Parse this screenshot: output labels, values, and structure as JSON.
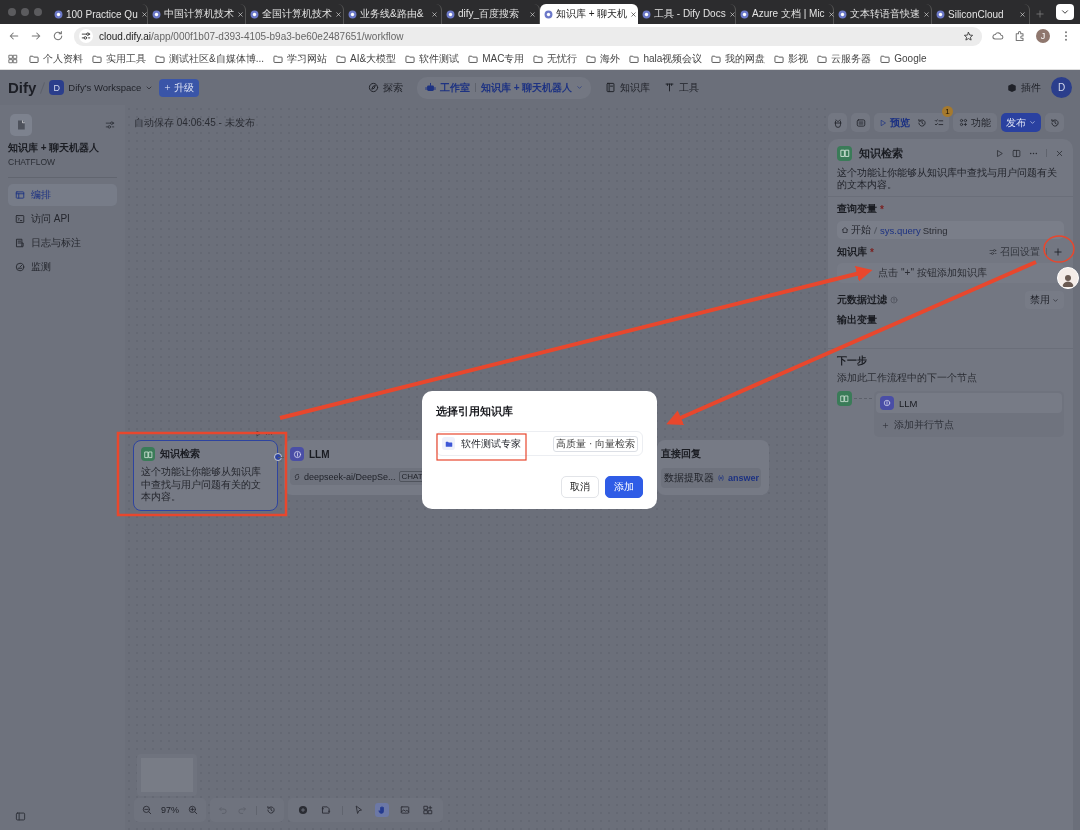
{
  "browser": {
    "tabs": [
      {
        "title": "100 Practice Qu",
        "selected": false
      },
      {
        "title": "中国计算机技术",
        "selected": false
      },
      {
        "title": "全国计算机技术",
        "selected": false
      },
      {
        "title": "业务线&路由&",
        "selected": false
      },
      {
        "title": "dify_百度搜索",
        "selected": false
      },
      {
        "title": "知识库 + 聊天机",
        "selected": true
      },
      {
        "title": "工具 - Dify Docs",
        "selected": false
      },
      {
        "title": "Azure 文档 | Mic",
        "selected": false
      },
      {
        "title": "文本转语音快速",
        "selected": false
      },
      {
        "title": "SiliconCloud",
        "selected": false
      }
    ],
    "url": "**cloud.dify.ai**/app/000f1b07-d393-4105-b9a3-be60e2487651/workflow",
    "profile_initial": "J",
    "bookmarks": [
      "个人资料",
      "实用工具",
      "测试社区&自媒体博...",
      "学习网站",
      "AI&大模型",
      "软件测试",
      "MAC专用",
      "无忧行",
      "海外",
      "hala视频会议",
      "我的网盘",
      "影视",
      "云服务器",
      "Google"
    ]
  },
  "header": {
    "logo": "Dify",
    "workspace_initial": "D",
    "workspace": "Dify's Workspace",
    "upgrade": "升级",
    "nav": [
      {
        "kind": "explore",
        "label": "探索"
      },
      {
        "kind": "studio",
        "label": "工作室",
        "app": "知识库 + 聊天机器人"
      },
      {
        "kind": "knowledge",
        "label": "知识库"
      },
      {
        "kind": "tools",
        "label": "工具"
      }
    ],
    "plugins": "插件",
    "user_initial": "D"
  },
  "sidebar": {
    "app_name": "知识库 + 聊天机器人",
    "app_type": "CHATFLOW",
    "items": [
      {
        "kind": "orchestrate",
        "label": "编排",
        "selected": true
      },
      {
        "kind": "api",
        "label": "访问 API",
        "selected": false
      },
      {
        "kind": "logs",
        "label": "日志与标注",
        "selected": false
      },
      {
        "kind": "monitor",
        "label": "监测",
        "selected": false
      }
    ]
  },
  "canvas": {
    "autosave": "自动保存 04:06:45 - 未发布",
    "nodes": [
      {
        "kind": "knowledge",
        "title": "知识检索",
        "description": "这个功能让你能够从知识库中查找与用户问题有关的文本内容。",
        "selected": true
      },
      {
        "kind": "llm",
        "title": "LLM",
        "model": "deepseek-ai/DeepSe...",
        "mode": "CHAT",
        "selected": false
      },
      {
        "kind": "answer",
        "title": "直接回复",
        "source": "数据提取器",
        "variable": "answer",
        "selected": false
      }
    ],
    "zoom": "97%",
    "tools": [
      {
        "kind": "add",
        "selected": false
      },
      {
        "kind": "note",
        "selected": false
      },
      {
        "kind": "pointer",
        "selected": false
      },
      {
        "kind": "hand",
        "selected": true
      },
      {
        "kind": "image",
        "selected": false
      },
      {
        "kind": "layout",
        "selected": false
      }
    ]
  },
  "toolbar": {
    "preview": "预览",
    "checklist_count": "1",
    "features": "功能",
    "publish": "发布"
  },
  "panel": {
    "title": "知识检索",
    "description": "这个功能让你能够从知识库中查找与用户问题有关的文本内容。",
    "query_label": "查询变量",
    "query_mark": "*",
    "query_source": "开始",
    "query_var": "sys.query",
    "query_type": "String",
    "kb_label": "知识库",
    "kb_mark": "*",
    "recall": "召回设置",
    "kb_empty": "点击 \"+\" 按钮添加知识库",
    "metadata_label": "元数据过滤",
    "metadata_value": "禁用",
    "output_label": "输出变量",
    "next_label": "下一步",
    "next_desc": "添加此工作流程中的下一个节点",
    "next_node": "LLM",
    "add_parallel": "添加并行节点"
  },
  "dialog": {
    "title": "选择引用知识库",
    "item": "软件测试专家",
    "item_tag": "高质量 · 向量检索",
    "cancel": "取消",
    "confirm": "添加"
  }
}
